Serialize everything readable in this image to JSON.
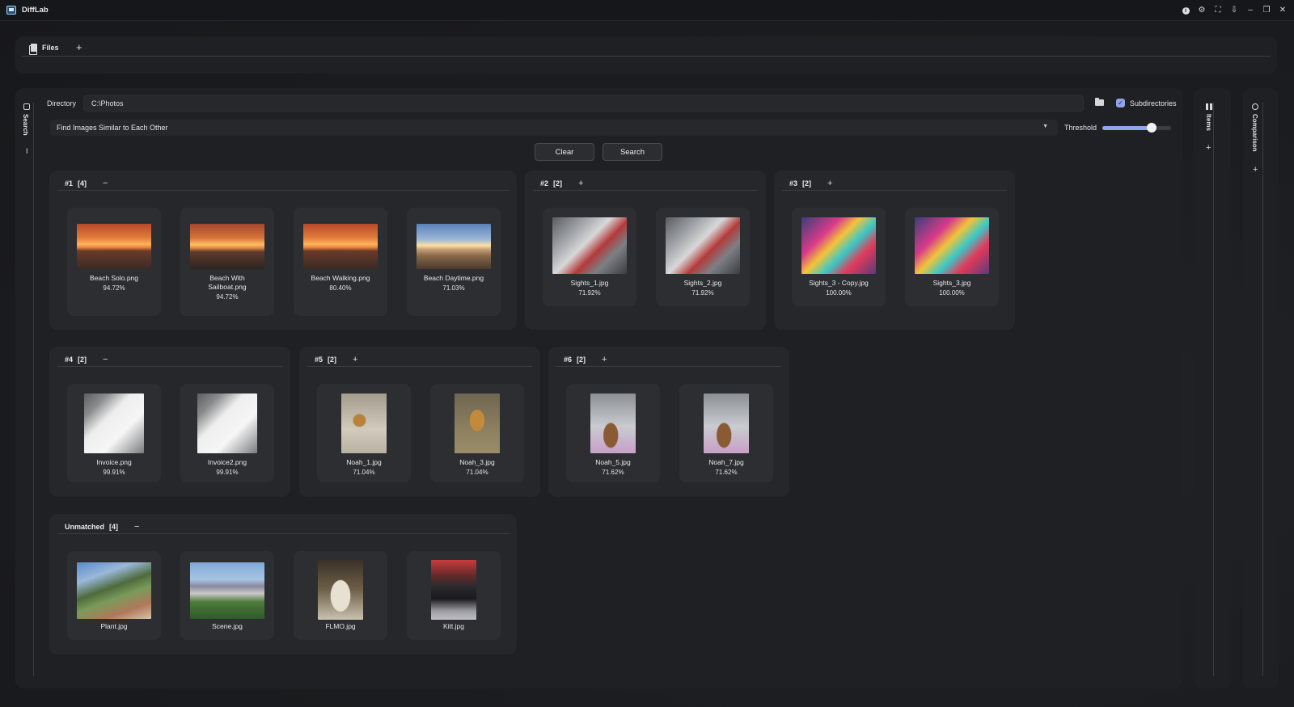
{
  "app": {
    "title": "DiffLab"
  },
  "titlebar_icons": [
    "info-icon",
    "gear-icon",
    "fullscreen-icon",
    "pin-icon",
    "minimize-icon",
    "restore-icon",
    "close-icon"
  ],
  "files": {
    "tab_label": "Files",
    "add_label": "+"
  },
  "search_panel": {
    "side_label": "Search",
    "side_toggle": "I",
    "directory_label": "Directory",
    "directory_value": "C:\\Photos",
    "subdirectories_label": "Subdirectories",
    "subdirectories_checked": true,
    "mode_value": "Find Images Similar to Each Other",
    "threshold_label": "Threshold",
    "threshold_level": 0.72,
    "clear_label": "Clear",
    "search_label": "Search",
    "accent_color": "#8fa5e6"
  },
  "groups": [
    {
      "id": "#1",
      "count": "[4]",
      "toggle": "−",
      "items": [
        {
          "name": "Beach Solo.png",
          "pct": "94.72%",
          "art": "sunset"
        },
        {
          "name": "Beach With Sailboat.png",
          "pct": "94.72%",
          "art": "sunset2"
        },
        {
          "name": "Beach Walking.png",
          "pct": "80.40%",
          "art": "sunset"
        },
        {
          "name": "Beach Daytime.png",
          "pct": "71.03%",
          "art": "daytime"
        }
      ]
    },
    {
      "id": "#2",
      "count": "[2]",
      "toggle": "+",
      "items": [
        {
          "name": "Sights_1.jpg",
          "pct": "71.92%",
          "art": "car"
        },
        {
          "name": "Sights_2.jpg",
          "pct": "71.92%",
          "art": "car"
        }
      ]
    },
    {
      "id": "#3",
      "count": "[2]",
      "toggle": "+",
      "items": [
        {
          "name": "Sights_3 - Copy.jpg",
          "pct": "100.00%",
          "art": "arcade"
        },
        {
          "name": "Sights_3.jpg",
          "pct": "100.00%",
          "art": "arcade"
        }
      ]
    },
    {
      "id": "#4",
      "count": "[2]",
      "toggle": "−",
      "items": [
        {
          "name": "Invoice.png",
          "pct": "99.91%",
          "art": "paper"
        },
        {
          "name": "Invoice2.png",
          "pct": "99.91%",
          "art": "paper"
        }
      ]
    },
    {
      "id": "#5",
      "count": "[2]",
      "toggle": "+",
      "items": [
        {
          "name": "Noah_1.jpg",
          "pct": "71.04%",
          "art": "dog1"
        },
        {
          "name": "Noah_3.jpg",
          "pct": "71.04%",
          "art": "dog2"
        }
      ]
    },
    {
      "id": "#6",
      "count": "[2]",
      "toggle": "+",
      "items": [
        {
          "name": "Noah_5.jpg",
          "pct": "71.62%",
          "art": "dog3"
        },
        {
          "name": "Noah_7.jpg",
          "pct": "71.62%",
          "art": "dog3"
        }
      ]
    }
  ],
  "unmatched": {
    "label": "Unmatched",
    "count": "[4]",
    "toggle": "−",
    "items": [
      {
        "name": "Plant.jpg",
        "art": "plant"
      },
      {
        "name": "Scene.jpg",
        "art": "scene"
      },
      {
        "name": "FLMO.jpg",
        "art": "flmo"
      },
      {
        "name": "Kitt.jpg",
        "art": "kitt"
      }
    ]
  },
  "items_panel": {
    "label": "Items",
    "add": "+"
  },
  "comparison_panel": {
    "label": "Comparison",
    "add": "+"
  }
}
